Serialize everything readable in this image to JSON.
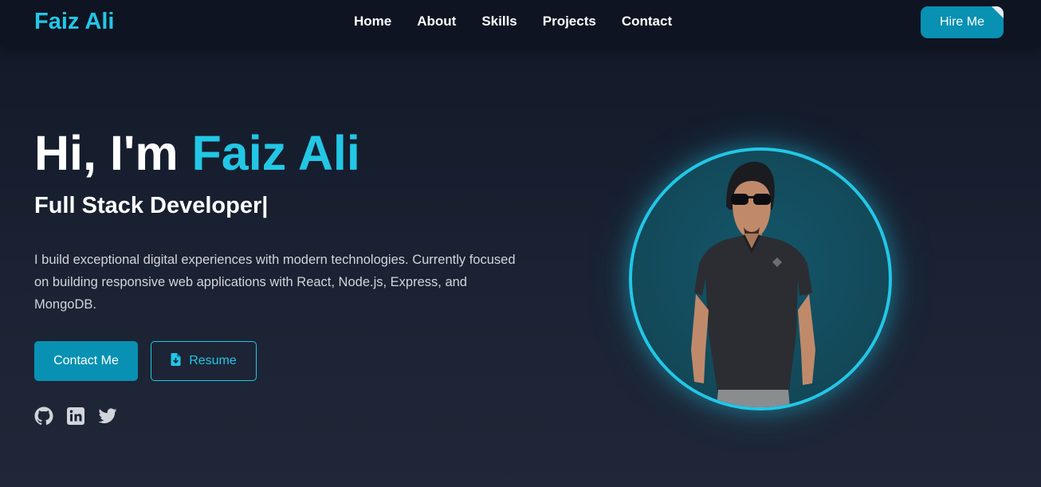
{
  "nav": {
    "logo": "Faiz Ali",
    "links": [
      "Home",
      "About",
      "Skills",
      "Projects",
      "Contact"
    ],
    "hire_label": "Hire Me"
  },
  "hero": {
    "greeting": "Hi, I'm ",
    "name": "Faiz Ali",
    "role": "Full Stack Developer|",
    "description": "I build exceptional digital experiences with modern technologies. Currently focused on building responsive web applications with React, Node.js, Express, and MongoDB.",
    "contact_label": "Contact Me",
    "resume_label": "Resume",
    "resume_icon": "file-download-icon"
  },
  "socials": [
    {
      "name": "github-icon"
    },
    {
      "name": "linkedin-icon"
    },
    {
      "name": "twitter-icon"
    }
  ],
  "colors": {
    "accent": "#22c7e6",
    "button": "#0891b2",
    "background": "#111827",
    "text_muted": "#d1d5db"
  }
}
